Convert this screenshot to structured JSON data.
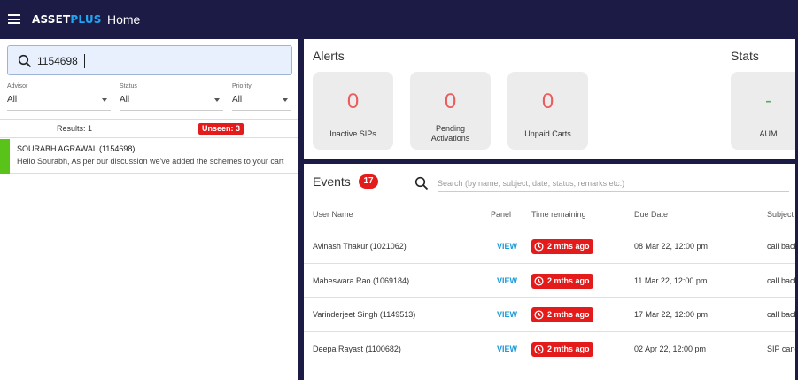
{
  "app": {
    "logo_main": "ASSET",
    "logo_accent": "PLUS",
    "page_title": "Home"
  },
  "left": {
    "search_value": "1154698",
    "filters": [
      {
        "label": "Advisor",
        "value": "All"
      },
      {
        "label": "Status",
        "value": "All"
      },
      {
        "label": "Priority",
        "value": "All"
      }
    ],
    "results": "Results: 1",
    "unseen": "Unseen: 3",
    "conversation": {
      "name": "SOURABH AGRAWAL (1154698)",
      "message": "Hello Sourabh, As per our discussion we've added the schemes to your cart"
    }
  },
  "alerts": {
    "title": "Alerts",
    "cards": [
      {
        "value": "0",
        "label": "Inactive SIPs"
      },
      {
        "value": "0",
        "label_line1": "Pending",
        "label_line2": "Activations"
      },
      {
        "value": "0",
        "label": "Unpaid Carts"
      }
    ]
  },
  "stats": {
    "title": "Stats",
    "cards": [
      {
        "value": "-",
        "label": "AUM"
      }
    ]
  },
  "events": {
    "title": "Events",
    "count": "17",
    "search_placeholder": "Search (by name, subject, date, status, remarks etc.)",
    "columns": [
      "User Name",
      "Panel",
      "Time remaining",
      "Due Date",
      "Subject"
    ],
    "rows": [
      {
        "user": "Avinash Thakur (1021062)",
        "panel": "VIEW",
        "time": "2 mths ago",
        "due": "08 Mar 22, 12:00 pm",
        "subject": "call back"
      },
      {
        "user": "Maheswara Rao (1069184)",
        "panel": "VIEW",
        "time": "2 mths ago",
        "due": "11 Mar 22, 12:00 pm",
        "subject": "call back"
      },
      {
        "user": "Varinderjeet Singh (1149513)",
        "panel": "VIEW",
        "time": "2 mths ago",
        "due": "17 Mar 22, 12:00 pm",
        "subject": "call back"
      },
      {
        "user": "Deepa Rayast (1100682)",
        "panel": "VIEW",
        "time": "2 mths ago",
        "due": "02 Apr 22, 12:00 pm",
        "subject": "SIP cancel"
      }
    ]
  },
  "colors": {
    "topbar": "#1b1b45",
    "accent_blue": "#21a6f3",
    "alert_red": "#e31b1b",
    "zero_red": "#ec5c5c",
    "unread_green": "#5ac31a",
    "link_blue": "#1a9ad9"
  }
}
